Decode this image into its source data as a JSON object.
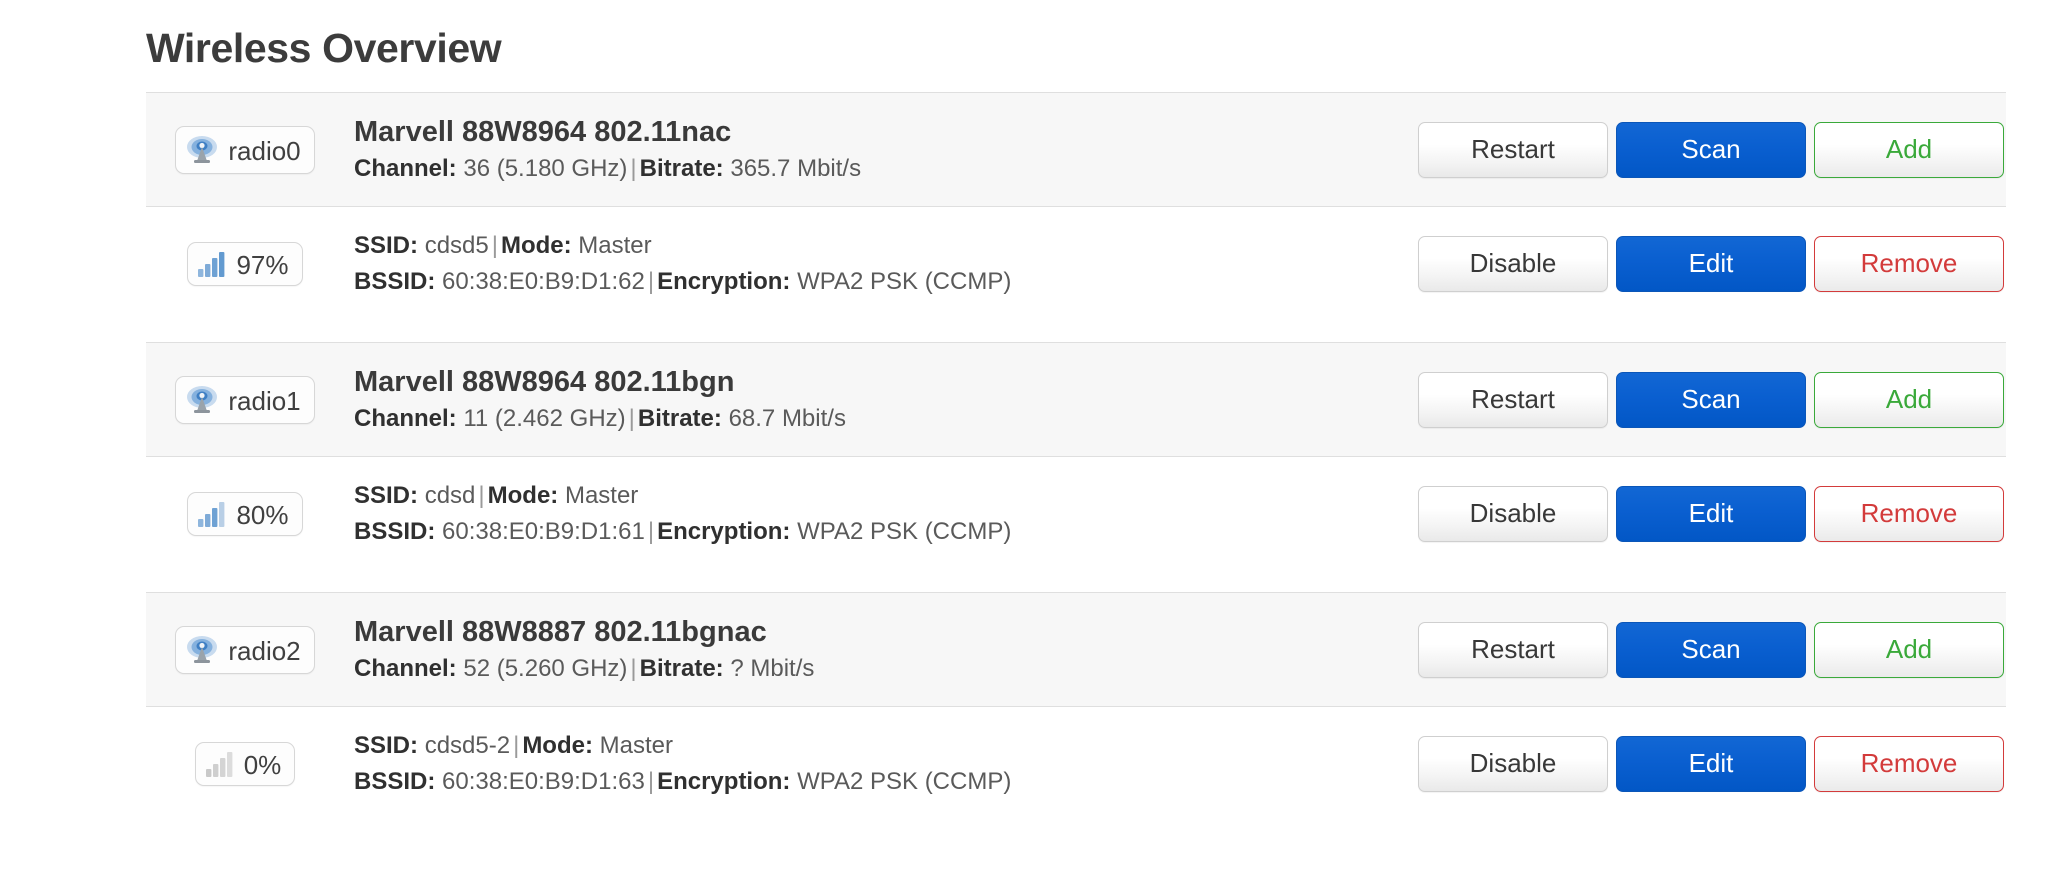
{
  "header": {
    "title": "Wireless Overview"
  },
  "colors": {
    "primary_blue": "#0a5fd0",
    "add_green": "#3aa93a",
    "remove_red": "#d33b3b",
    "row_header_bg": "#f7f7f7",
    "text": "#404040",
    "signal_blue": "#7aa9d8",
    "signal_gray": "#c9c9c9"
  },
  "sections": [
    {
      "device": {
        "badge_icon": "antenna-icon",
        "badge_label": "radio0",
        "title": "Marvell 88W8964 802.11nac",
        "detail": {
          "channel_label": "Channel:",
          "channel_value": "36 (5.180 GHz)",
          "separator": "|",
          "bitrate_label": "Bitrate:",
          "bitrate_value": "365.7 Mbit/s"
        },
        "buttons": {
          "restart": "Restart",
          "scan": "Scan",
          "add": "Add"
        }
      },
      "iface": {
        "badge_icon": "signal-bars-icon",
        "badge_label": "97%",
        "signal_percent": 97,
        "line1": {
          "ssid_label": "SSID:",
          "ssid_value": "cdsd5",
          "separator": "|",
          "mode_label": "Mode:",
          "mode_value": "Master"
        },
        "line2": {
          "bssid_label": "BSSID:",
          "bssid_value": "60:38:E0:B9:D1:62",
          "separator": "|",
          "encryption_label": "Encryption:",
          "encryption_value": "WPA2 PSK (CCMP)"
        },
        "buttons": {
          "disable": "Disable",
          "edit": "Edit",
          "remove": "Remove"
        }
      }
    },
    {
      "device": {
        "badge_icon": "antenna-icon",
        "badge_label": "radio1",
        "title": "Marvell 88W8964 802.11bgn",
        "detail": {
          "channel_label": "Channel:",
          "channel_value": "11 (2.462 GHz)",
          "separator": "|",
          "bitrate_label": "Bitrate:",
          "bitrate_value": "68.7 Mbit/s"
        },
        "buttons": {
          "restart": "Restart",
          "scan": "Scan",
          "add": "Add"
        }
      },
      "iface": {
        "badge_icon": "signal-bars-icon",
        "badge_label": "80%",
        "signal_percent": 80,
        "line1": {
          "ssid_label": "SSID:",
          "ssid_value": "cdsd",
          "separator": "|",
          "mode_label": "Mode:",
          "mode_value": "Master"
        },
        "line2": {
          "bssid_label": "BSSID:",
          "bssid_value": "60:38:E0:B9:D1:61",
          "separator": "|",
          "encryption_label": "Encryption:",
          "encryption_value": "WPA2 PSK (CCMP)"
        },
        "buttons": {
          "disable": "Disable",
          "edit": "Edit",
          "remove": "Remove"
        }
      }
    },
    {
      "device": {
        "badge_icon": "antenna-icon",
        "badge_label": "radio2",
        "title": "Marvell 88W8887 802.11bgnac",
        "detail": {
          "channel_label": "Channel:",
          "channel_value": "52 (5.260 GHz)",
          "separator": "|",
          "bitrate_label": "Bitrate:",
          "bitrate_value": "? Mbit/s"
        },
        "buttons": {
          "restart": "Restart",
          "scan": "Scan",
          "add": "Add"
        }
      },
      "iface": {
        "badge_icon": "signal-bars-icon",
        "badge_label": "0%",
        "signal_percent": 0,
        "line1": {
          "ssid_label": "SSID:",
          "ssid_value": "cdsd5-2",
          "separator": "|",
          "mode_label": "Mode:",
          "mode_value": "Master"
        },
        "line2": {
          "bssid_label": "BSSID:",
          "bssid_value": "60:38:E0:B9:D1:63",
          "separator": "|",
          "encryption_label": "Encryption:",
          "encryption_value": "WPA2 PSK (CCMP)"
        },
        "buttons": {
          "disable": "Disable",
          "edit": "Edit",
          "remove": "Remove"
        }
      }
    }
  ]
}
